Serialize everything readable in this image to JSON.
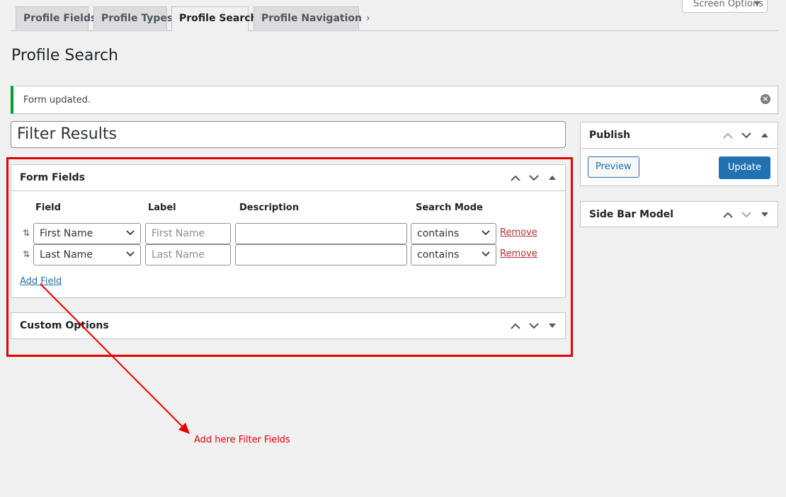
{
  "tabs": [
    {
      "label": "Profile Fields"
    },
    {
      "label": "Profile Types"
    },
    {
      "label": "Profile Search"
    },
    {
      "label": "Profile Navigation"
    }
  ],
  "screen_options": {
    "label": "Screen Options"
  },
  "page_title": "Profile Search",
  "notice": {
    "text": "Form updated."
  },
  "title_input": {
    "value": "Filter Results"
  },
  "form_fields": {
    "title": "Form Fields",
    "columns": [
      "Field",
      "Label",
      "Description",
      "Search Mode"
    ],
    "rows": [
      {
        "field": "First Name",
        "label_placeholder": "First Name",
        "description": "",
        "mode": "contains",
        "remove": "Remove"
      },
      {
        "field": "Last Name",
        "label_placeholder": "Last Name",
        "description": "",
        "mode": "contains",
        "remove": "Remove"
      }
    ],
    "add_field": "Add Field"
  },
  "custom_options": {
    "title": "Custom Options"
  },
  "publish": {
    "title": "Publish",
    "preview": "Preview",
    "update": "Update"
  },
  "sidebar_model": {
    "title": "Side Bar Model"
  },
  "annotation": {
    "text": "Add here Filter Fields",
    "color": "#e50000"
  },
  "colors": {
    "accent": "#2271b1",
    "success": "#00a32a",
    "danger": "#b32d2e"
  }
}
